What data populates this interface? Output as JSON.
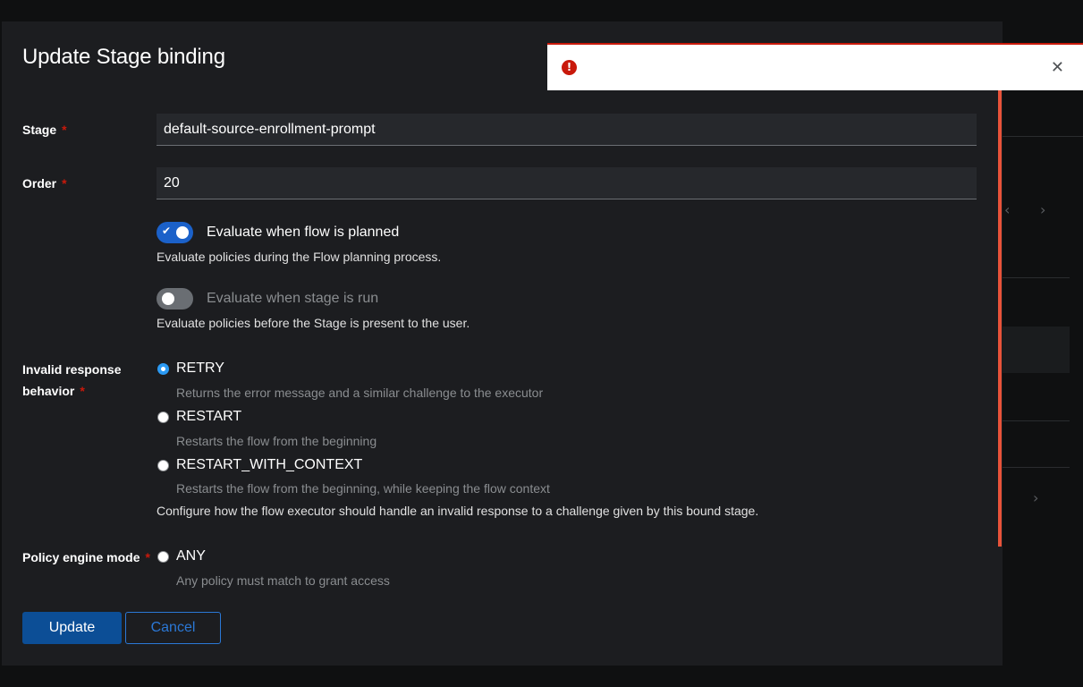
{
  "modal": {
    "title": "Update Stage binding",
    "stage": {
      "label": "Stage",
      "required": "*",
      "value": "default-source-enrollment-prompt"
    },
    "order": {
      "label": "Order",
      "required": "*",
      "value": "20"
    },
    "evaluate_on_plan": {
      "label": "Evaluate when flow is planned",
      "helper": "Evaluate policies during the Flow planning process.",
      "checked": true
    },
    "re_evaluate_policies": {
      "label": "Evaluate when stage is run",
      "helper": "Evaluate policies before the Stage is present to the user.",
      "checked": false
    },
    "invalid_response": {
      "label_line1": "Invalid response",
      "label_line2": "behavior",
      "required": "*",
      "options": [
        {
          "label": "RETRY",
          "desc": "Returns the error message and a similar challenge to the executor",
          "checked": true
        },
        {
          "label": "RESTART",
          "desc": "Restarts the flow from the beginning",
          "checked": false
        },
        {
          "label": "RESTART_WITH_CONTEXT",
          "desc": "Restarts the flow from the beginning, while keeping the flow context",
          "checked": false
        }
      ],
      "helper": "Configure how the flow executor should handle an invalid response to a challenge given by this bound stage."
    },
    "policy_engine_mode": {
      "label": "Policy engine mode",
      "required": "*",
      "options": [
        {
          "label": "ANY",
          "desc": "Any policy must match to grant access",
          "checked": false
        }
      ]
    },
    "buttons": {
      "update": "Update",
      "cancel": "Cancel"
    }
  },
  "alert": {
    "icon": "error-circle-icon",
    "close_glyph": "✕",
    "accent_color": "#c9190b"
  }
}
